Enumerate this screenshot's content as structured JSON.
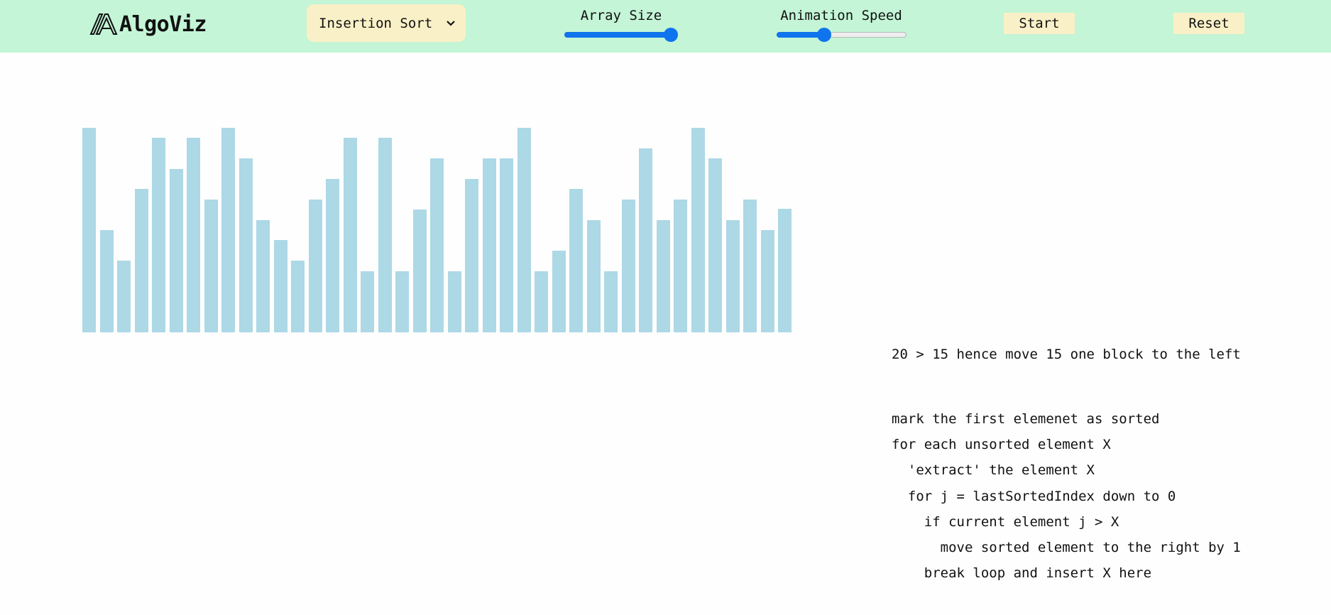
{
  "app": {
    "logo_text": "AlgoViz"
  },
  "controls": {
    "algorithm_select": {
      "value": "Insertion Sort"
    },
    "array_size": {
      "label": "Array Size",
      "fraction": 1.0
    },
    "animation_speed": {
      "label": "Animation Speed",
      "fraction": 0.35
    },
    "start_label": "Start",
    "reset_label": "Reset"
  },
  "array": {
    "bar_color": "#add8e6",
    "values": [
      20,
      10,
      7,
      14,
      19,
      16,
      19,
      13,
      20,
      17,
      11,
      9,
      7,
      13,
      15,
      19,
      6,
      19,
      6,
      12,
      17,
      6,
      15,
      17,
      17,
      20,
      6,
      8,
      14,
      11,
      6,
      13,
      18,
      11,
      13,
      20,
      17,
      11,
      13,
      10,
      12.1
    ],
    "max_value": 20
  },
  "explanation": {
    "text": "20 > 15 hence move 15 one block to the left"
  },
  "pseudocode": {
    "lines": [
      "mark the first elemenet as sorted",
      "for each unsorted element X",
      "  'extract' the element X",
      "  for j = lastSortedIndex down to 0",
      "    if current element j > X",
      "      move sorted element to the right by 1",
      "    break loop and insert X here"
    ]
  },
  "theme": {
    "topbar_bg": "#c3f5d6",
    "button_bg": "#faf0c7",
    "slider_accent": "#0f74ee"
  }
}
